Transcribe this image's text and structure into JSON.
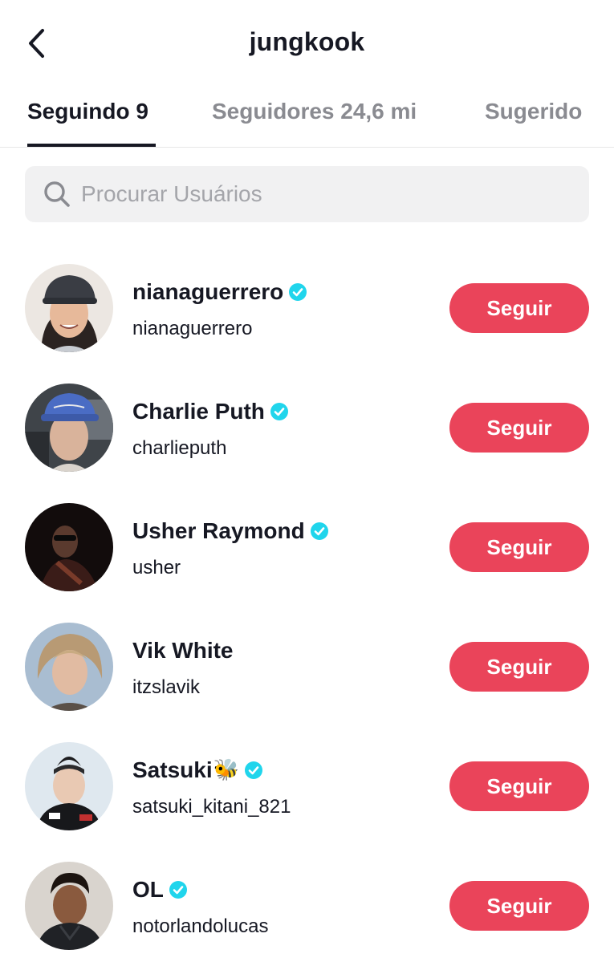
{
  "header": {
    "title": "jungkook",
    "back_icon": "chevron-left-icon"
  },
  "tabs": [
    {
      "label": "Seguindo 9",
      "active": true
    },
    {
      "label": "Seguidores 24,6 mi",
      "active": false
    },
    {
      "label": "Sugerido",
      "active": false
    }
  ],
  "search": {
    "placeholder": "Procurar Usuários",
    "value": ""
  },
  "colors": {
    "accent": "#ea445a",
    "verified": "#20d5ec",
    "text": "#161823",
    "muted": "#8a8b91"
  },
  "users": [
    {
      "name": "nianaguerrero",
      "handle": "nianaguerrero",
      "verified": true,
      "button": "Seguir"
    },
    {
      "name": "Charlie Puth",
      "handle": "charlieputh",
      "verified": true,
      "button": "Seguir"
    },
    {
      "name": "Usher Raymond",
      "handle": "usher",
      "verified": true,
      "button": "Seguir"
    },
    {
      "name": "Vik White",
      "handle": "itzslavik",
      "verified": false,
      "button": "Seguir"
    },
    {
      "name": "Satsuki",
      "name_emoji": "🐝",
      "handle": "satsuki_kitani_821",
      "verified": true,
      "button": "Seguir"
    },
    {
      "name": "OL",
      "handle": "notorlandolucas",
      "verified": true,
      "button": "Seguir"
    }
  ]
}
